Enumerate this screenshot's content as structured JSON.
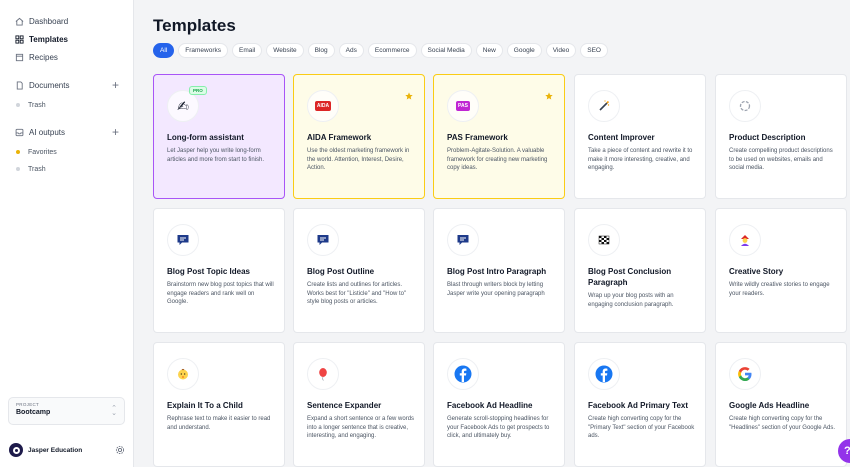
{
  "sidebar": {
    "nav": [
      {
        "label": "Dashboard",
        "icon": "home-icon"
      },
      {
        "label": "Templates",
        "icon": "grid-icon",
        "active": true
      },
      {
        "label": "Recipes",
        "icon": "book-icon"
      }
    ],
    "documents": {
      "label": "Documents",
      "trash": "Trash"
    },
    "ai_outputs": {
      "label": "AI outputs",
      "favorites": "Favorites",
      "trash": "Trash"
    },
    "project": {
      "label": "PROJECT",
      "name": "Bootcamp"
    },
    "user": {
      "name": "Jasper Education"
    }
  },
  "main": {
    "title": "Templates",
    "tabs": [
      "All",
      "Frameworks",
      "Email",
      "Website",
      "Blog",
      "Ads",
      "Ecommerce",
      "Social Media",
      "New",
      "Google",
      "Video",
      "SEO"
    ],
    "cards": [
      {
        "title": "Long-form assistant",
        "desc": "Let Jasper help you write long-form articles and more from start to finish.",
        "badge": "PRO",
        "style": "purple",
        "icon": "pen-hand-icon"
      },
      {
        "title": "AIDA Framework",
        "desc": "Use the oldest marketing framework in the world. Attention, Interest, Desire, Action.",
        "style": "yellow",
        "badge_text": "AIDA",
        "icon": "aida-badge-icon"
      },
      {
        "title": "PAS Framework",
        "desc": "Problem-Agitate-Solution. A valuable framework for creating new marketing copy ideas.",
        "style": "yellow",
        "badge_text": "PAS",
        "icon": "pas-badge-icon"
      },
      {
        "title": "Content Improver",
        "desc": "Take a piece of content and rewrite it to make it more interesting, creative, and engaging.",
        "style": "plain",
        "icon": "magic-wand-icon"
      },
      {
        "title": "Product Description",
        "desc": "Create compelling product descriptions to be used on websites, emails and social media.",
        "style": "plain",
        "icon": "ribbon-icon"
      },
      {
        "title": "Blog Post Topic Ideas",
        "desc": "Brainstorm new blog post topics that will engage readers and rank well on Google.",
        "style": "plain",
        "icon": "chat-bubble-icon"
      },
      {
        "title": "Blog Post Outline",
        "desc": "Create lists and outlines for articles. Works best for \"Listicle\" and \"How to\" style blog posts or articles.",
        "style": "plain",
        "icon": "chat-bubble-icon"
      },
      {
        "title": "Blog Post Intro Paragraph",
        "desc": "Blast through writers block by letting Jasper write your opening paragraph",
        "style": "plain",
        "icon": "chat-bubble-icon"
      },
      {
        "title": "Blog Post Conclusion Paragraph",
        "desc": "Wrap up your blog posts with an engaging conclusion paragraph.",
        "style": "plain",
        "icon": "checkered-flag-icon"
      },
      {
        "title": "Creative Story",
        "desc": "Write wildly creative stories to engage your readers.",
        "style": "plain",
        "icon": "storyteller-icon"
      },
      {
        "title": "Explain It To a Child",
        "desc": "Rephrase text to make it easier to read and understand.",
        "style": "plain",
        "icon": "baby-icon"
      },
      {
        "title": "Sentence Expander",
        "desc": "Expand a short sentence or a few words into a longer sentence that is creative, interesting, and engaging.",
        "style": "plain",
        "icon": "balloon-icon"
      },
      {
        "title": "Facebook Ad Headline",
        "desc": "Generate scroll-stopping headlines for your Facebook Ads to get prospects to click, and ultimately buy.",
        "style": "plain",
        "icon": "facebook-icon"
      },
      {
        "title": "Facebook Ad Primary Text",
        "desc": "Create high converting copy for the \"Primary Text\" section of your Facebook ads.",
        "style": "plain",
        "icon": "facebook-icon"
      },
      {
        "title": "Google Ads Headline",
        "desc": "Create high converting copy for the \"Headlines\" section of your Google Ads.",
        "style": "plain",
        "icon": "google-icon"
      }
    ]
  },
  "help": {
    "label": "?"
  },
  "colors": {
    "accent": "#2563eb",
    "purple_card": "#a855f7",
    "yellow_card": "#facc15",
    "facebook": "#1877f2",
    "help": "#9333ea"
  }
}
